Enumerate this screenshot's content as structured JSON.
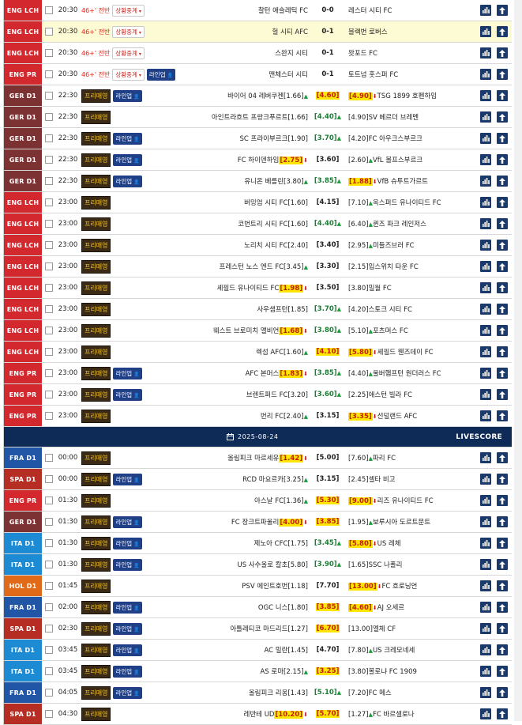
{
  "colors": {
    "league_red": "#d2282e",
    "ita_blue": "#1d8bd4",
    "fra_blue": "#2155a5",
    "hol_orange": "#e06a17",
    "spa_maroon": "#b52d23",
    "ger_maroon": "#7c3232",
    "date_bar": "#0e2a57",
    "icon_navy": "#1b3a6b"
  },
  "section1": [
    {
      "league": "ENG LCH",
      "color": "#d2282e",
      "time": "20:30",
      "minute": "46+' 전반",
      "status": "상황중계",
      "lineup": "",
      "pre": "",
      "home": "찰턴 애슬레틱 FC",
      "score": "0-0",
      "score_style": "",
      "away": "레스터 시티 FC",
      "hl": false
    },
    {
      "league": "ENG LCH",
      "color": "#d2282e",
      "time": "20:30",
      "minute": "46+' 전반",
      "status": "상황중계",
      "lineup": "",
      "pre": "",
      "home": "헐 시티 AFC",
      "score": "0-1",
      "score_style": "",
      "away": "블랙번 로버스",
      "hl": true
    },
    {
      "league": "ENG LCH",
      "color": "#d2282e",
      "time": "20:30",
      "minute": "46+' 전반",
      "status": "상황중계",
      "lineup": "",
      "pre": "",
      "home": "스완지 시티",
      "score": "0-1",
      "score_style": "",
      "away": "왓포드 FC",
      "hl": false
    },
    {
      "league": "ENG PR",
      "color": "#d2282e",
      "time": "20:30",
      "minute": "46+' 전반",
      "status": "상황중계",
      "lineup": "라인업",
      "pre": "",
      "home": "맨체스터 시티",
      "score": "0-1",
      "score_style": "",
      "away": "토트넘 홋스퍼 FC",
      "hl": false
    },
    {
      "league": "GER D1",
      "color": "#7c3232",
      "time": "22:30",
      "minute": "",
      "status": "",
      "lineup": "라인업",
      "pre": "프리매영",
      "home": "바이어 04 레버쿠젠",
      "home_odd": "[1.66]",
      "home_odd_dir": "up",
      "home_odd_hl": false,
      "score": "[4.60]",
      "score_style": "yd",
      "away": "TSG 1899 호펜하임",
      "away_odd": "[4.90]",
      "away_odd_dir": "dn",
      "away_odd_hl": true,
      "hl": false
    },
    {
      "league": "GER D1",
      "color": "#7c3232",
      "time": "22:30",
      "minute": "",
      "status": "",
      "lineup": "",
      "pre": "프리매영",
      "home": "아인트라흐트 프랑크푸르트",
      "home_odd": "[1.66]",
      "home_odd_dir": "",
      "home_odd_hl": false,
      "score": "[4.40]",
      "score_style": "gu",
      "away": "SV 베르더 브레멘",
      "away_odd": "[4.90]",
      "away_odd_dir": "",
      "away_odd_hl": false,
      "hl": false
    },
    {
      "league": "GER D1",
      "color": "#7c3232",
      "time": "22:30",
      "minute": "",
      "status": "",
      "lineup": "라인업",
      "pre": "프리매영",
      "home": "SC 프라이부르크",
      "home_odd": "[1.90]",
      "home_odd_dir": "",
      "home_odd_hl": false,
      "score": "[3.70]",
      "score_style": "gu",
      "away": "FC 아우크스부르크",
      "away_odd": "[4.20]",
      "away_odd_dir": "",
      "away_odd_hl": false,
      "hl": false
    },
    {
      "league": "GER D1",
      "color": "#7c3232",
      "time": "22:30",
      "minute": "",
      "status": "",
      "lineup": "라인업",
      "pre": "프리매영",
      "home": "FC 하이덴하임",
      "home_odd": "[2.75]",
      "home_odd_dir": "dn",
      "home_odd_hl": true,
      "score": "[3.60]",
      "score_style": "",
      "away": "VfL 볼프스부르크",
      "away_odd": "[2.60]",
      "away_odd_dir": "up",
      "away_odd_hl": false,
      "hl": false
    },
    {
      "league": "GER D1",
      "color": "#7c3232",
      "time": "22:30",
      "minute": "",
      "status": "",
      "lineup": "라인업",
      "pre": "프리매영",
      "home": "유니온 베를린",
      "home_odd": "[3.80]",
      "home_odd_dir": "up",
      "home_odd_hl": false,
      "score": "[3.85]",
      "score_style": "gu",
      "away": "VfB 슈투트가르트",
      "away_odd": "[1.88]",
      "away_odd_dir": "dn",
      "away_odd_hl": true,
      "hl": false
    },
    {
      "league": "ENG LCH",
      "color": "#d2282e",
      "time": "23:00",
      "minute": "",
      "status": "",
      "lineup": "",
      "pre": "프리매영",
      "home": "버밍엄 시티 FC",
      "home_odd": "[1.60]",
      "home_odd_dir": "",
      "home_odd_hl": false,
      "score": "[4.15]",
      "score_style": "",
      "away": "옥스퍼드 유나이티드 FC",
      "away_odd": "[7.10]",
      "away_odd_dir": "up",
      "away_odd_hl": false,
      "hl": false
    },
    {
      "league": "ENG LCH",
      "color": "#d2282e",
      "time": "23:00",
      "minute": "",
      "status": "",
      "lineup": "",
      "pre": "프리매영",
      "home": "코번트리 시티 FC",
      "home_odd": "[1.60]",
      "home_odd_dir": "",
      "home_odd_hl": false,
      "score": "[4.40]",
      "score_style": "gu",
      "away": "퀸즈 파크 레인저스",
      "away_odd": "[6.40]",
      "away_odd_dir": "up",
      "away_odd_hl": false,
      "hl": false
    },
    {
      "league": "ENG LCH",
      "color": "#d2282e",
      "time": "23:00",
      "minute": "",
      "status": "",
      "lineup": "",
      "pre": "프리매영",
      "home": "노리치 시티 FC",
      "home_odd": "[2.40]",
      "home_odd_dir": "",
      "home_odd_hl": false,
      "score": "[3.40]",
      "score_style": "",
      "away": "미들즈브러 FC",
      "away_odd": "[2.95]",
      "away_odd_dir": "up",
      "away_odd_hl": false,
      "hl": false
    },
    {
      "league": "ENG LCH",
      "color": "#d2282e",
      "time": "23:00",
      "minute": "",
      "status": "",
      "lineup": "",
      "pre": "프리매영",
      "home": "프레스턴 노스 엔드 FC",
      "home_odd": "[3.45]",
      "home_odd_dir": "up",
      "home_odd_hl": false,
      "score": "[3.30]",
      "score_style": "",
      "away": "입스위치 타운 FC",
      "away_odd": "[2.15]",
      "away_odd_dir": "",
      "away_odd_hl": false,
      "hl": false
    },
    {
      "league": "ENG LCH",
      "color": "#d2282e",
      "time": "23:00",
      "minute": "",
      "status": "",
      "lineup": "",
      "pre": "프리매영",
      "home": "셰필드 유나이티드 FC",
      "home_odd": "[1.98]",
      "home_odd_dir": "dn",
      "home_odd_hl": true,
      "score": "[3.50]",
      "score_style": "",
      "away": "밀월 FC",
      "away_odd": "[3.80]",
      "away_odd_dir": "",
      "away_odd_hl": false,
      "hl": false
    },
    {
      "league": "ENG LCH",
      "color": "#d2282e",
      "time": "23:00",
      "minute": "",
      "status": "",
      "lineup": "",
      "pre": "프리매영",
      "home": "사우샘프턴",
      "home_odd": "[1.85]",
      "home_odd_dir": "",
      "home_odd_hl": false,
      "score": "[3.70]",
      "score_style": "gu",
      "away": "스토크 시티 FC",
      "away_odd": "[4.20]",
      "away_odd_dir": "",
      "away_odd_hl": false,
      "hl": false
    },
    {
      "league": "ENG LCH",
      "color": "#d2282e",
      "time": "23:00",
      "minute": "",
      "status": "",
      "lineup": "",
      "pre": "프리매영",
      "home": "웨스트 브로미치 앨비언",
      "home_odd": "[1.68]",
      "home_odd_dir": "dn",
      "home_odd_hl": true,
      "score": "[3.80]",
      "score_style": "gu",
      "away": "포츠머스 FC",
      "away_odd": "[5.10]",
      "away_odd_dir": "up",
      "away_odd_hl": false,
      "hl": false
    },
    {
      "league": "ENG LCH",
      "color": "#d2282e",
      "time": "23:00",
      "minute": "",
      "status": "",
      "lineup": "",
      "pre": "프리매영",
      "home": "렉섬 AFC",
      "home_odd": "[1.60]",
      "home_odd_dir": "up",
      "home_odd_hl": false,
      "score": "[4.10]",
      "score_style": "yd",
      "away": "셰필드 웬즈데이 FC",
      "away_odd": "[5.80]",
      "away_odd_dir": "dn",
      "away_odd_hl": true,
      "hl": false
    },
    {
      "league": "ENG PR",
      "color": "#d2282e",
      "time": "23:00",
      "minute": "",
      "status": "",
      "lineup": "라인업",
      "pre": "프리매영",
      "home": "AFC 본머스",
      "home_odd": "[1.83]",
      "home_odd_dir": "dn",
      "home_odd_hl": true,
      "score": "[3.85]",
      "score_style": "gu",
      "away": "울버햄프턴 원더러스 FC",
      "away_odd": "[4.40]",
      "away_odd_dir": "up",
      "away_odd_hl": false,
      "hl": false
    },
    {
      "league": "ENG PR",
      "color": "#d2282e",
      "time": "23:00",
      "minute": "",
      "status": "",
      "lineup": "라인업",
      "pre": "프리매영",
      "home": "브렌트퍼드 FC",
      "home_odd": "[3.20]",
      "home_odd_dir": "",
      "home_odd_hl": false,
      "score": "[3.60]",
      "score_style": "gu",
      "away": "애스턴 빌라 FC",
      "away_odd": "[2.25]",
      "away_odd_dir": "",
      "away_odd_hl": false,
      "hl": false
    },
    {
      "league": "ENG PR",
      "color": "#d2282e",
      "time": "23:00",
      "minute": "",
      "status": "",
      "lineup": "",
      "pre": "프리매영",
      "home": "번리 FC",
      "home_odd": "[2.40]",
      "home_odd_dir": "up",
      "home_odd_hl": false,
      "score": "[3.15]",
      "score_style": "",
      "away": "선덜랜드 AFC",
      "away_odd": "[3.35]",
      "away_odd_dir": "dn",
      "away_odd_hl": true,
      "hl": false
    }
  ],
  "date_bar": {
    "date": "2025-08-24",
    "livescore": "LIVESCORE"
  },
  "section2": [
    {
      "league": "FRA D1",
      "color": "#2155a5",
      "time": "00:00",
      "lineup": "",
      "pre": "프리매영",
      "home": "올림피크 마르세유",
      "home_odd": "[1.42]",
      "home_odd_dir": "dn",
      "home_odd_hl": true,
      "score": "[5.00]",
      "score_style": "",
      "away": "파리 FC",
      "away_odd": "[7.60]",
      "away_odd_dir": "up",
      "away_odd_hl": false
    },
    {
      "league": "SPA D1",
      "color": "#b52d23",
      "time": "00:00",
      "lineup": "라인업",
      "pre": "프리매영",
      "home": "RCD 마요르카",
      "home_odd": "[3.25]",
      "home_odd_dir": "up",
      "home_odd_hl": false,
      "score": "[3.15]",
      "score_style": "",
      "away": "셀타 비고",
      "away_odd": "[2.45]",
      "away_odd_dir": "",
      "away_odd_hl": false
    },
    {
      "league": "ENG PR",
      "color": "#d2282e",
      "time": "01:30",
      "lineup": "",
      "pre": "프리매영",
      "home": "아스날 FC",
      "home_odd": "[1.36]",
      "home_odd_dir": "up",
      "home_odd_hl": false,
      "score": "[5.30]",
      "score_style": "yd",
      "away": "리즈 유나이티드 FC",
      "away_odd": "[9.00]",
      "away_odd_dir": "dn",
      "away_odd_hl": true
    },
    {
      "league": "GER D1",
      "color": "#7c3232",
      "time": "01:30",
      "lineup": "라인업",
      "pre": "프리매영",
      "home": "FC 장크트파울리",
      "home_odd": "[4.00]",
      "home_odd_dir": "dn",
      "home_odd_hl": true,
      "score": "[3.85]",
      "score_style": "yd",
      "away": "보루시아 도르트문트",
      "away_odd": "[1.95]",
      "away_odd_dir": "up",
      "away_odd_hl": false
    },
    {
      "league": "ITA D1",
      "color": "#1d8bd4",
      "time": "01:30",
      "lineup": "라인업",
      "pre": "프리매영",
      "home": "제노아 CFC",
      "home_odd": "[1.75]",
      "home_odd_dir": "",
      "home_odd_hl": false,
      "score": "[3.45]",
      "score_style": "gu",
      "away": "US 레체",
      "away_odd": "[5.80]",
      "away_odd_dir": "dn",
      "away_odd_hl": true
    },
    {
      "league": "ITA D1",
      "color": "#1d8bd4",
      "time": "01:30",
      "lineup": "라인업",
      "pre": "프리매영",
      "home": "US 사수올로 칼초",
      "home_odd": "[5.80]",
      "home_odd_dir": "",
      "home_odd_hl": false,
      "score": "[3.90]",
      "score_style": "gu",
      "away": "SSC 나폴리",
      "away_odd": "[1.65]",
      "away_odd_dir": "",
      "away_odd_hl": false
    },
    {
      "league": "HOL D1",
      "color": "#e06a17",
      "time": "01:45",
      "lineup": "",
      "pre": "프리매영",
      "home": "PSV 에인트호번",
      "home_odd": "[1.18]",
      "home_odd_dir": "",
      "home_odd_hl": false,
      "score": "[7.70]",
      "score_style": "",
      "away": "FC 흐로닝언",
      "away_odd": "[13.00]",
      "away_odd_dir": "dn",
      "away_odd_hl": true
    },
    {
      "league": "FRA D1",
      "color": "#2155a5",
      "time": "02:00",
      "lineup": "라인업",
      "pre": "프리매영",
      "home": "OGC 니스",
      "home_odd": "[1.80]",
      "home_odd_dir": "",
      "home_odd_hl": false,
      "score": "[3.85]",
      "score_style": "yd",
      "away": "AJ 오세르",
      "away_odd": "[4.60]",
      "away_odd_dir": "dn",
      "away_odd_hl": true
    },
    {
      "league": "SPA D1",
      "color": "#b52d23",
      "time": "02:30",
      "lineup": "라인업",
      "pre": "프리매영",
      "home": "아틀레티코 마드리드",
      "home_odd": "[1.27]",
      "home_odd_dir": "",
      "home_odd_hl": false,
      "score": "[6.70]",
      "score_style": "yd",
      "away": "엘체 CF",
      "away_odd": "[13.00]",
      "away_odd_dir": "",
      "away_odd_hl": false
    },
    {
      "league": "ITA D1",
      "color": "#1d8bd4",
      "time": "03:45",
      "lineup": "라인업",
      "pre": "프리매영",
      "home": "AC 밀란",
      "home_odd": "[1.45]",
      "home_odd_dir": "",
      "home_odd_hl": false,
      "score": "[4.70]",
      "score_style": "",
      "away": "US 크레모네세",
      "away_odd": "[7.80]",
      "away_odd_dir": "up",
      "away_odd_hl": false
    },
    {
      "league": "ITA D1",
      "color": "#1d8bd4",
      "time": "03:45",
      "lineup": "라인업",
      "pre": "프리매영",
      "home": "AS 로마",
      "home_odd": "[2.15]",
      "home_odd_dir": "up",
      "home_odd_hl": false,
      "score": "[3.25]",
      "score_style": "yd",
      "away": "볼로냐 FC 1909",
      "away_odd": "[3.80]",
      "away_odd_dir": "",
      "away_odd_hl": false
    },
    {
      "league": "FRA D1",
      "color": "#2155a5",
      "time": "04:05",
      "lineup": "라인업",
      "pre": "프리매영",
      "home": "올림피크 리옹",
      "home_odd": "[1.43]",
      "home_odd_dir": "",
      "home_odd_hl": false,
      "score": "[5.10]",
      "score_style": "gu",
      "away": "FC 메스",
      "away_odd": "[7.20]",
      "away_odd_dir": "",
      "away_odd_hl": false
    },
    {
      "league": "SPA D1",
      "color": "#b52d23",
      "time": "04:30",
      "lineup": "",
      "pre": "프리매영",
      "home": "레반테 UD",
      "home_odd": "[10.20]",
      "home_odd_dir": "dn",
      "home_odd_hl": true,
      "score": "[5.70]",
      "score_style": "yd",
      "away": "FC 바르셀로나",
      "away_odd": "[1.27]",
      "away_odd_dir": "up",
      "away_odd_hl": false
    }
  ]
}
